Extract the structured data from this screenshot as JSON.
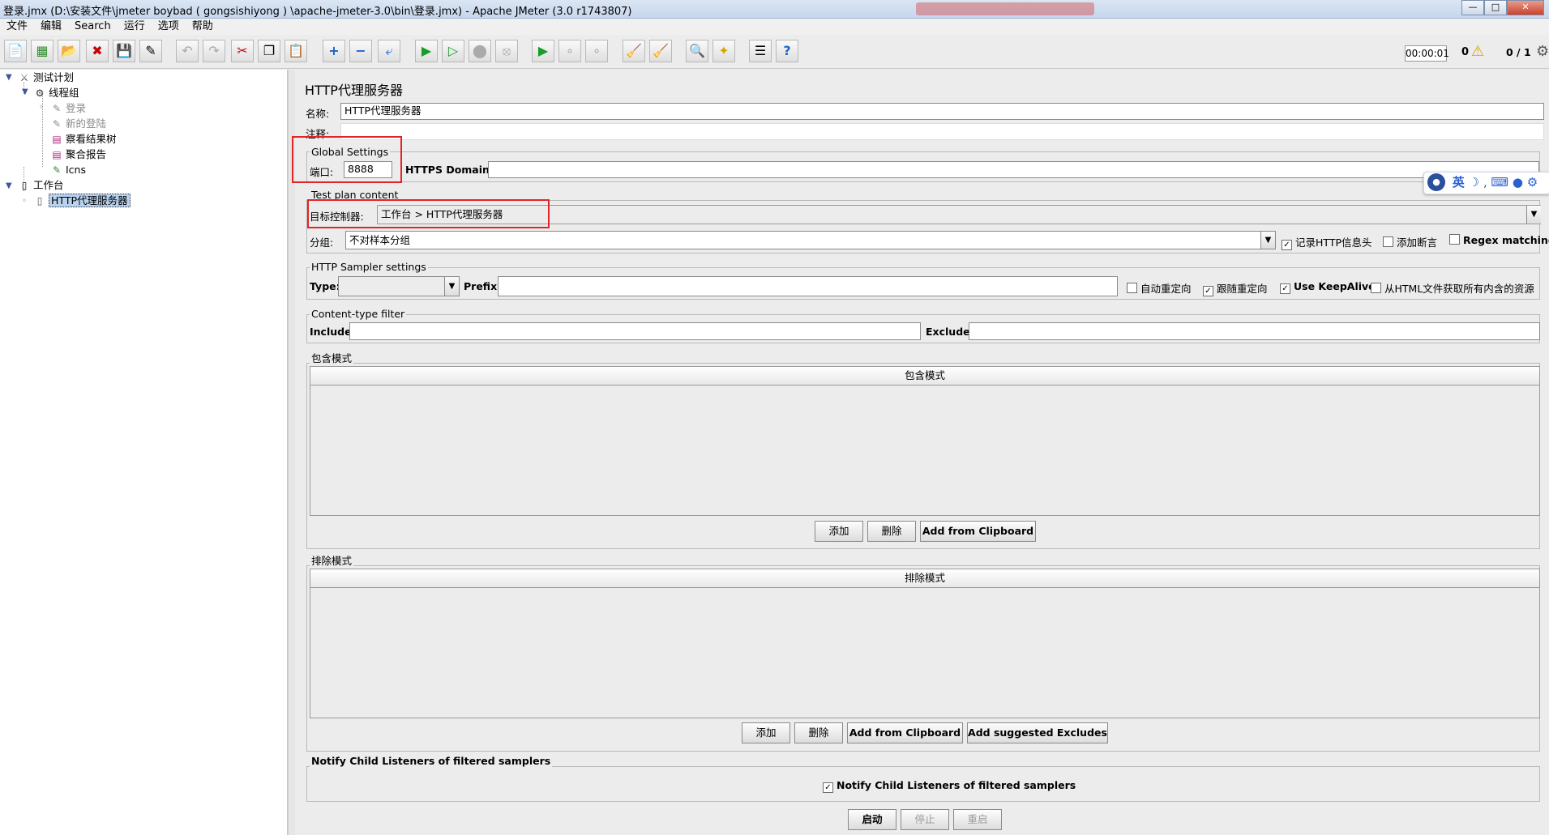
{
  "window": {
    "title": "登录.jmx (D:\\安装文件\\jmeter   boybad ( gongsishiyong ) \\apache-jmeter-3.0\\bin\\登录.jmx) - Apache JMeter (3.0 r1743807)"
  },
  "menubar": [
    "文件",
    "编辑",
    "Search",
    "运行",
    "选项",
    "帮助"
  ],
  "status": {
    "time": "00:00:01",
    "warnings": "0",
    "threads": "0 / 1"
  },
  "tree": {
    "test_plan": "测试计划",
    "thread_group": "线程组",
    "login": "登录",
    "new_login": "新的登陆",
    "results_tree": "察看结果树",
    "aggregate_report": "聚合报告",
    "icns": "Icns",
    "workbench": "工作台",
    "proxy": "HTTP代理服务器"
  },
  "panel": {
    "title": "HTTP代理服务器",
    "name_label": "名称:",
    "name_value": "HTTP代理服务器",
    "comment_label": "注释:",
    "global_settings": {
      "title": "Global Settings",
      "port_label": "端口:",
      "port_value": "8888",
      "https_label": "HTTPS Domains :",
      "https_value": ""
    },
    "test_plan_content": {
      "title": "Test plan content",
      "target_label": "目标控制器:",
      "target_value": "工作台 > HTTP代理服务器",
      "group_label": "分组:",
      "group_value": "不对样本分组",
      "record_headers": {
        "label": "记录HTTP信息头",
        "checked": true
      },
      "add_assertions": {
        "label": "添加断言",
        "checked": false
      },
      "regex_matching": {
        "label": "Regex matching",
        "checked": false
      }
    },
    "sampler_settings": {
      "title": "HTTP Sampler settings",
      "type_label": "Type:",
      "type_value": "",
      "prefix_label": "Prefix:",
      "prefix_value": "",
      "auto_redirect": {
        "label": "自动重定向",
        "checked": false
      },
      "follow_redirect": {
        "label": "跟随重定向",
        "checked": true
      },
      "keepalive": {
        "label": "Use KeepAlive",
        "checked": true
      },
      "embedded": {
        "label": "从HTML文件获取所有内含的资源",
        "checked": false
      }
    },
    "content_filter": {
      "title": "Content-type filter",
      "include_label": "Include:",
      "include_value": "",
      "exclude_label": "Exclude:",
      "exclude_value": ""
    },
    "include_patterns": {
      "title": "包含模式",
      "column": "包含模式",
      "add": "添加",
      "delete": "删除",
      "clipboard": "Add from Clipboard"
    },
    "exclude_patterns": {
      "title": "排除模式",
      "column": "排除模式",
      "add": "添加",
      "delete": "删除",
      "clipboard": "Add from Clipboard",
      "suggested": "Add suggested Excludes"
    },
    "notify": {
      "title": "Notify Child Listeners of filtered samplers",
      "checkbox": {
        "label": "Notify Child Listeners of filtered samplers",
        "checked": true
      }
    },
    "controls": {
      "start": "启动",
      "stop": "停止",
      "restart": "重启"
    }
  },
  "ime": {
    "lang": "英"
  },
  "highlight_color": "#e32424"
}
